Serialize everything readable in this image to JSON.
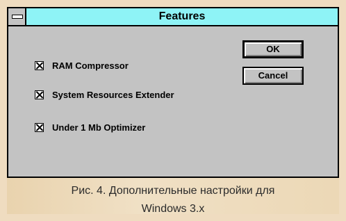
{
  "window": {
    "title": "Features",
    "options": [
      {
        "label": "RAM Compressor",
        "checked": true
      },
      {
        "label": "System Resources Extender",
        "checked": true
      },
      {
        "label": "Under 1 Mb Optimizer",
        "checked": true
      }
    ],
    "ok_label": "OK",
    "cancel_label": "Cancel"
  },
  "caption": {
    "line1": "Рис. 4. Дополнительные настройки для",
    "line2": "Windows 3.x"
  }
}
